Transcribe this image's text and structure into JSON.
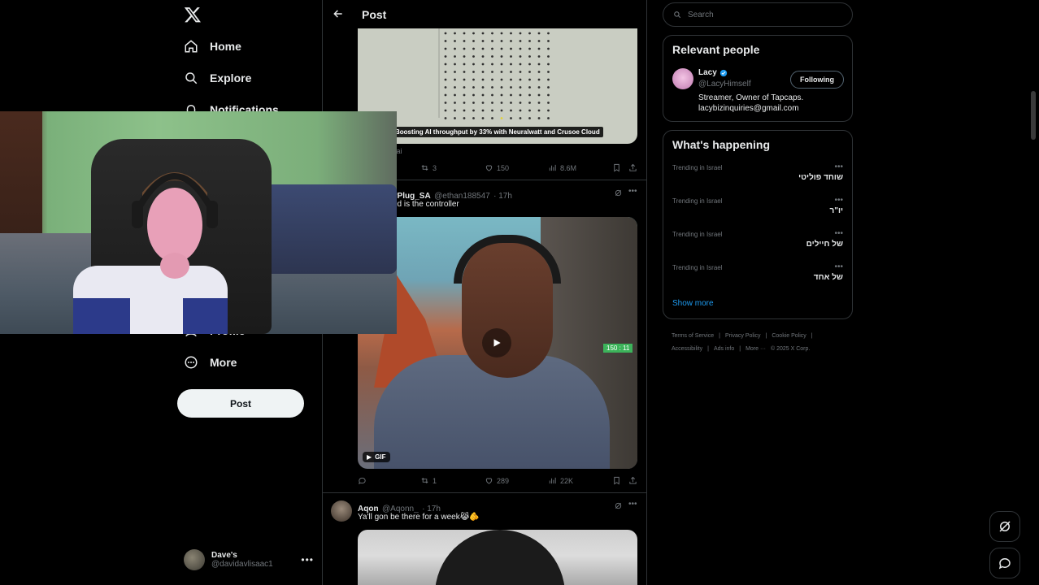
{
  "nav": {
    "items": [
      {
        "label": "Home",
        "icon": "home-icon"
      },
      {
        "label": "Explore",
        "icon": "search-icon"
      },
      {
        "label": "Notifications",
        "icon": "bell-icon"
      },
      {
        "label": "Profile",
        "icon": "profile-icon"
      },
      {
        "label": "More",
        "icon": "more-circle-icon"
      }
    ],
    "post_button": "Post",
    "account": {
      "name": "Dave's",
      "handle": "@davidavlisaac1"
    }
  },
  "header": {
    "title": "Post"
  },
  "tweets": [
    {
      "media_caption": "Boosting AI throughput by 33% with Neuralwatt and Crusoe Cloud",
      "fragment": ".ai",
      "retweets": "3",
      "likes": "150",
      "views": "8.6M"
    },
    {
      "name": "yPlug_SA",
      "handle": "@ethan188547",
      "time": "· 17h",
      "text": "ed is the controller",
      "gif_label": "GIF",
      "overlay_text": "150 : 11",
      "retweets": "1",
      "likes": "289",
      "views": "22K"
    },
    {
      "name": "Aqon",
      "handle": "@Aqonn_",
      "time": "· 17h",
      "text": "Ya'll gon be there for a week😹🫵"
    }
  ],
  "search": {
    "placeholder": "Search"
  },
  "relevant_people": {
    "title": "Relevant people",
    "name": "Lacy",
    "handle": "@LacyHimself",
    "bio_line1": "Streamer, Owner of Tapcaps.",
    "bio_line2": "lacybizinquiries@gmail.com",
    "follow_label": "Following"
  },
  "trending": {
    "title": "What's happening",
    "items": [
      {
        "context": "Trending in Israel",
        "name": "שוחד פוליטי"
      },
      {
        "context": "Trending in Israel",
        "name": "יו\"ר"
      },
      {
        "context": "Trending in Israel",
        "name": "של חיילים"
      },
      {
        "context": "Trending in Israel",
        "name": "של אחד"
      }
    ],
    "show_more": "Show more"
  },
  "footer": {
    "links": [
      "Terms of Service",
      "|",
      "Privacy Policy",
      "|",
      "Cookie Policy",
      "|",
      "Accessibility",
      "|",
      "Ads info",
      "|",
      "More ···",
      "© 2025 X Corp."
    ]
  },
  "colors": {
    "accent": "#1d9bf0",
    "background": "#000000",
    "border": "#2f3336",
    "muted": "#71767b"
  }
}
